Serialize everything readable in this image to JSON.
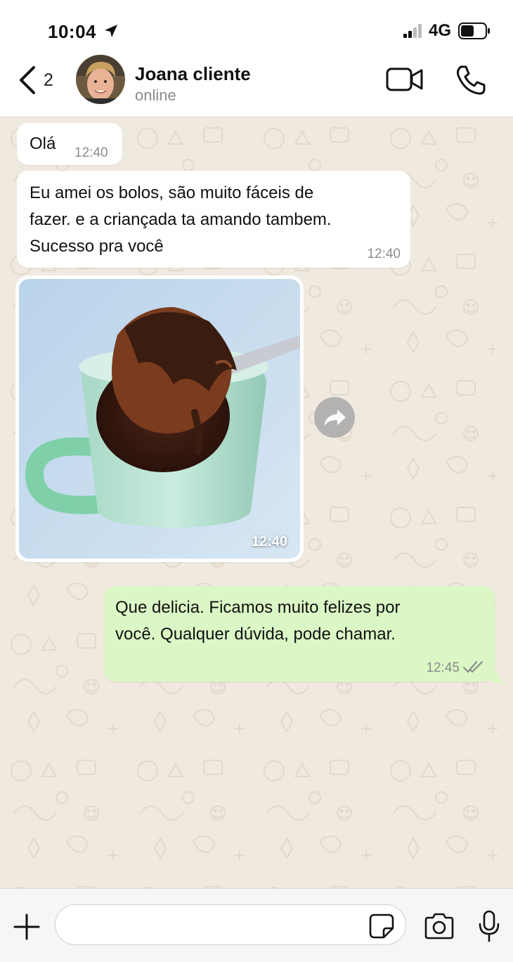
{
  "status_bar": {
    "time": "10:04",
    "network": "4G"
  },
  "header": {
    "back_count": "2",
    "contact_name": "Joana cliente",
    "contact_status": "online"
  },
  "messages": [
    {
      "direction": "in",
      "type": "text",
      "text": "Olá",
      "time": "12:40"
    },
    {
      "direction": "in",
      "type": "text",
      "text": "Eu amei os bolos, são muito fáceis de\nfazer. e a criançada ta amando tambem.\nSucesso pra você",
      "time": "12:40"
    },
    {
      "direction": "in",
      "type": "image",
      "image_subject": "mug cake with chocolate on a fork",
      "time": "12:40"
    },
    {
      "direction": "out",
      "type": "text",
      "text": "Que delicia. Ficamos muito felizes por\nvocê. Qualquer dúvida, pode chamar.",
      "time": "12:45",
      "status": "read"
    }
  ],
  "input": {
    "placeholder": ""
  },
  "colors": {
    "incoming_bubble": "#ffffff",
    "outgoing_bubble": "#dbf7c5",
    "chat_background": "#efe9df",
    "header_background": "#ffffff"
  },
  "icons": [
    "location-arrow-icon",
    "signal-icon",
    "battery-icon",
    "back-chevron-icon",
    "video-camera-icon",
    "phone-icon",
    "forward-icon",
    "double-check-icon",
    "plus-icon",
    "sticker-icon",
    "camera-icon",
    "microphone-icon"
  ]
}
